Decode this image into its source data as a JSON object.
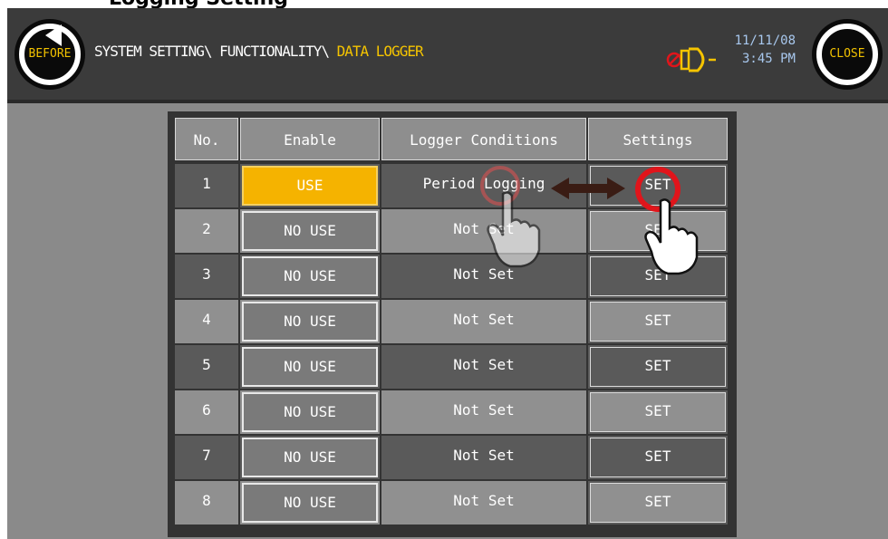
{
  "top_fragment": "Logging Setting",
  "header": {
    "before_label": "BEFORE",
    "close_label": "CLOSE",
    "breadcrumb_path": "SYSTEM SETTING\\ FUNCTIONALITY\\ ",
    "breadcrumb_current": "DATA LOGGER",
    "date": "11/11/08",
    "time": "3:45 PM",
    "alarm_icon": "alarm-muted-icon"
  },
  "table": {
    "headers": [
      "No.",
      "Enable",
      "Logger Conditions",
      "Settings"
    ],
    "rows": [
      {
        "no": "1",
        "enable": "USE",
        "condition": "Period Logging",
        "settings": "SET"
      },
      {
        "no": "2",
        "enable": "NO USE",
        "condition": "Not Set",
        "settings": "SET"
      },
      {
        "no": "3",
        "enable": "NO USE",
        "condition": "Not Set",
        "settings": "SET"
      },
      {
        "no": "4",
        "enable": "NO USE",
        "condition": "Not Set",
        "settings": "SET"
      },
      {
        "no": "5",
        "enable": "NO USE",
        "condition": "Not Set",
        "settings": "SET"
      },
      {
        "no": "6",
        "enable": "NO USE",
        "condition": "Not Set",
        "settings": "SET"
      },
      {
        "no": "7",
        "enable": "NO USE",
        "condition": "Not Set",
        "settings": "SET"
      },
      {
        "no": "8",
        "enable": "NO USE",
        "condition": "Not Set",
        "settings": "SET"
      }
    ]
  },
  "colors": {
    "accent_yellow": "#f5c400",
    "enable_on": "#f5b300",
    "datetime": "#a8c8ee",
    "highlight_ring": "#e0151b"
  }
}
